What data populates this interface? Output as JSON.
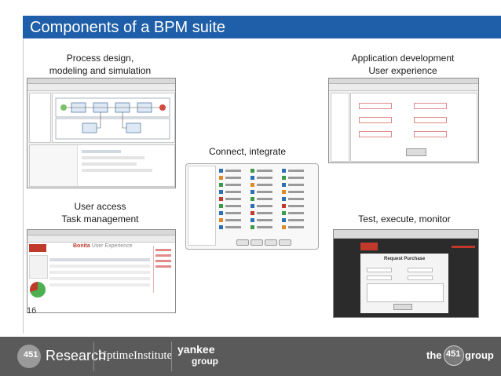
{
  "slide": {
    "title": "Components of a BPM suite",
    "slide_number": "16"
  },
  "panels": {
    "process_design": {
      "caption_line1": "Process design,",
      "caption_line2": "modeling and simulation",
      "window_title": "Bonita Studio"
    },
    "app_dev": {
      "caption_line1": "Application development",
      "caption_line2": "User experience",
      "window_title": "Bonita Studio"
    },
    "connect": {
      "caption": "Connect, integrate"
    },
    "user_access": {
      "caption_line1": "User access",
      "caption_line2": "Task management",
      "app_name": "Bonita",
      "app_subtitle": "User Experience"
    },
    "test_monitor": {
      "caption": "Test, execute, monitor",
      "form_title": "Request Purchase"
    }
  },
  "footer": {
    "research_label": "Research",
    "uptime_label": "UptimeInstitute",
    "yankee_line1": "yankee",
    "yankee_line2": "group",
    "the451_prefix": "the",
    "the451_number": "451",
    "the451_suffix": "group"
  },
  "colors": {
    "title_bar": "#1f5ea8",
    "footer": "#5a5a5a",
    "bonita_red": "#c0392b"
  }
}
